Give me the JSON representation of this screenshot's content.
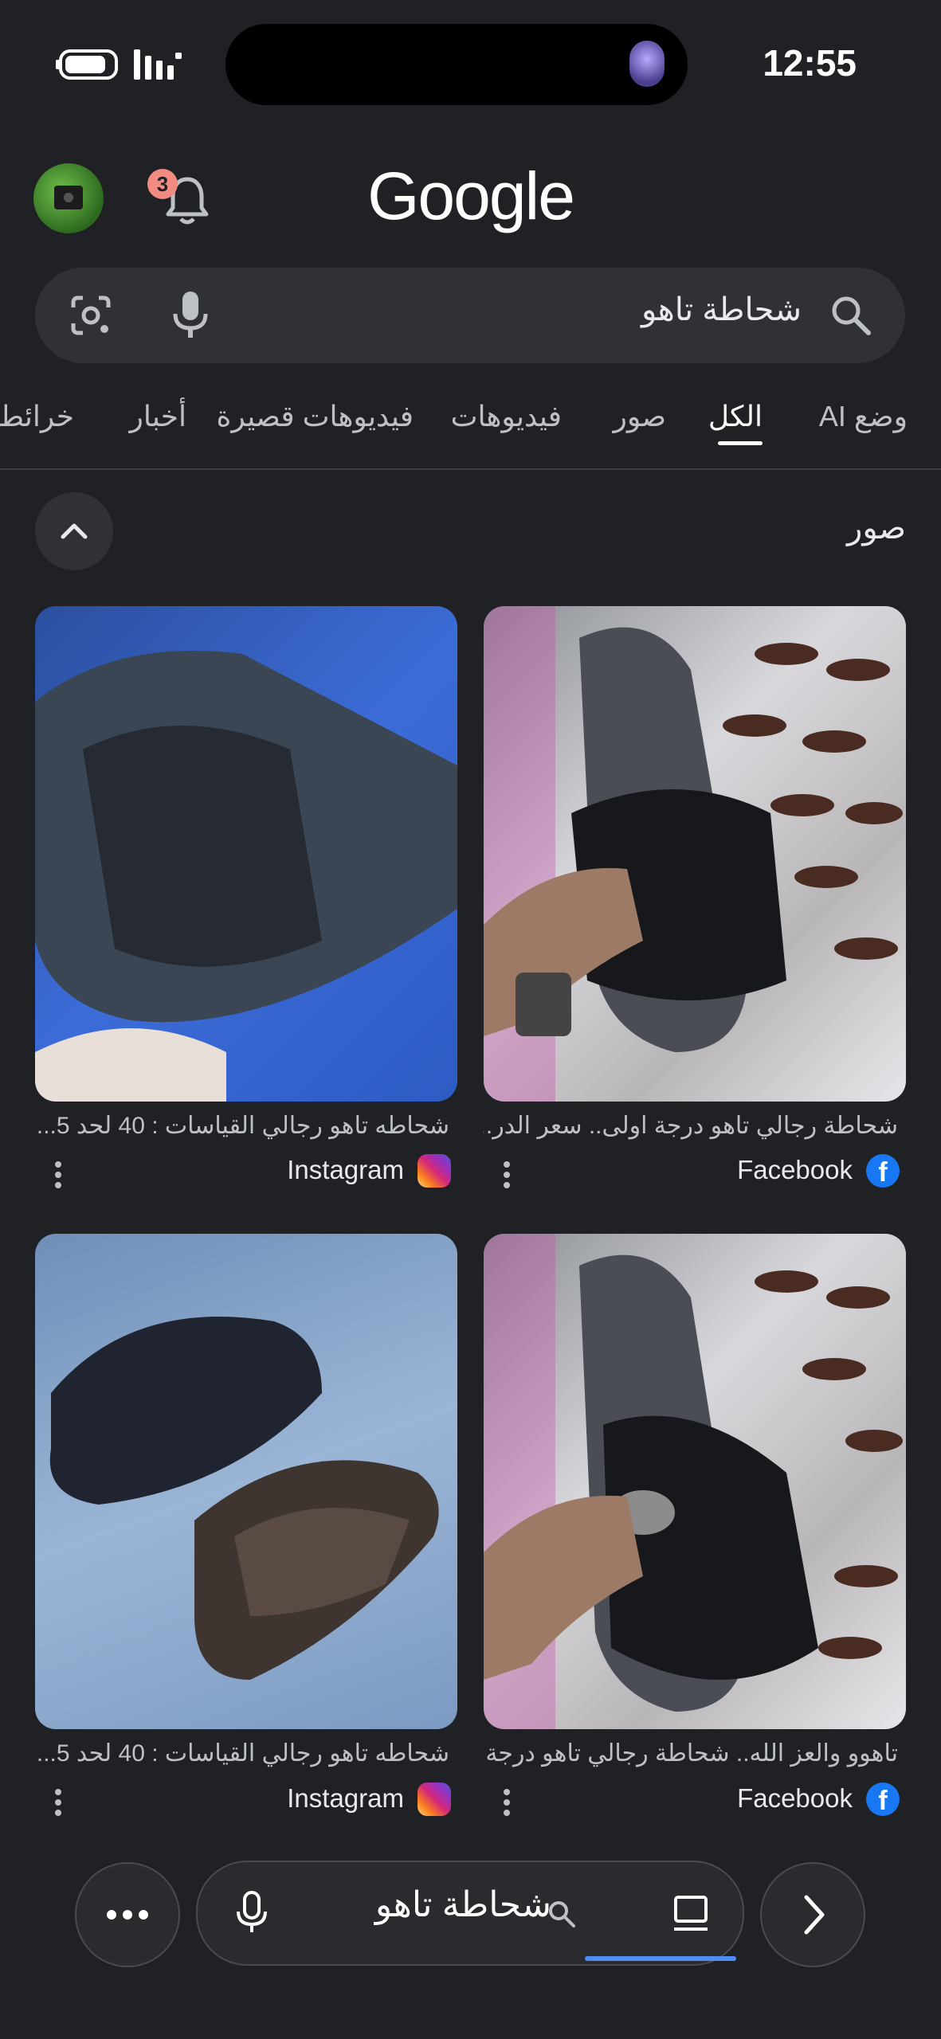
{
  "status_bar": {
    "time": "12:55"
  },
  "header": {
    "logo_text": "Google",
    "notification_count": "3"
  },
  "search": {
    "query": "شحاطة تاهو"
  },
  "tabs": [
    {
      "label": "وضع AI"
    },
    {
      "label": "الكل",
      "active": true
    },
    {
      "label": "صور"
    },
    {
      "label": "فيديوهات"
    },
    {
      "label": "فيديوهات قصيرة"
    },
    {
      "label": "أخبار"
    },
    {
      "label": "خرائط"
    }
  ],
  "images_section": {
    "title": "صور",
    "results": [
      {
        "caption": "شحاطة رجالي تاهو درجة اولى.. سعر الدر...",
        "source": "Facebook",
        "source_icon": "facebook-icon"
      },
      {
        "caption": "شحاطه تاهو رجالي القياسات : 40 لحد 5...",
        "source": "Instagram",
        "source_icon": "instagram-icon"
      },
      {
        "caption": "تاهوو والعز الله.. شحاطة رجالي تاهو درجة...",
        "source": "Facebook",
        "source_icon": "facebook-icon"
      },
      {
        "caption": "شحاطه تاهو رجالي القياسات : 40 لحد 5...",
        "source": "Instagram",
        "source_icon": "instagram-icon"
      }
    ]
  },
  "bottom_bar": {
    "query": "شحاطة تاهو"
  },
  "colors": {
    "background": "#202124",
    "accent": "#4c8df6",
    "badge": "#f28b82"
  }
}
